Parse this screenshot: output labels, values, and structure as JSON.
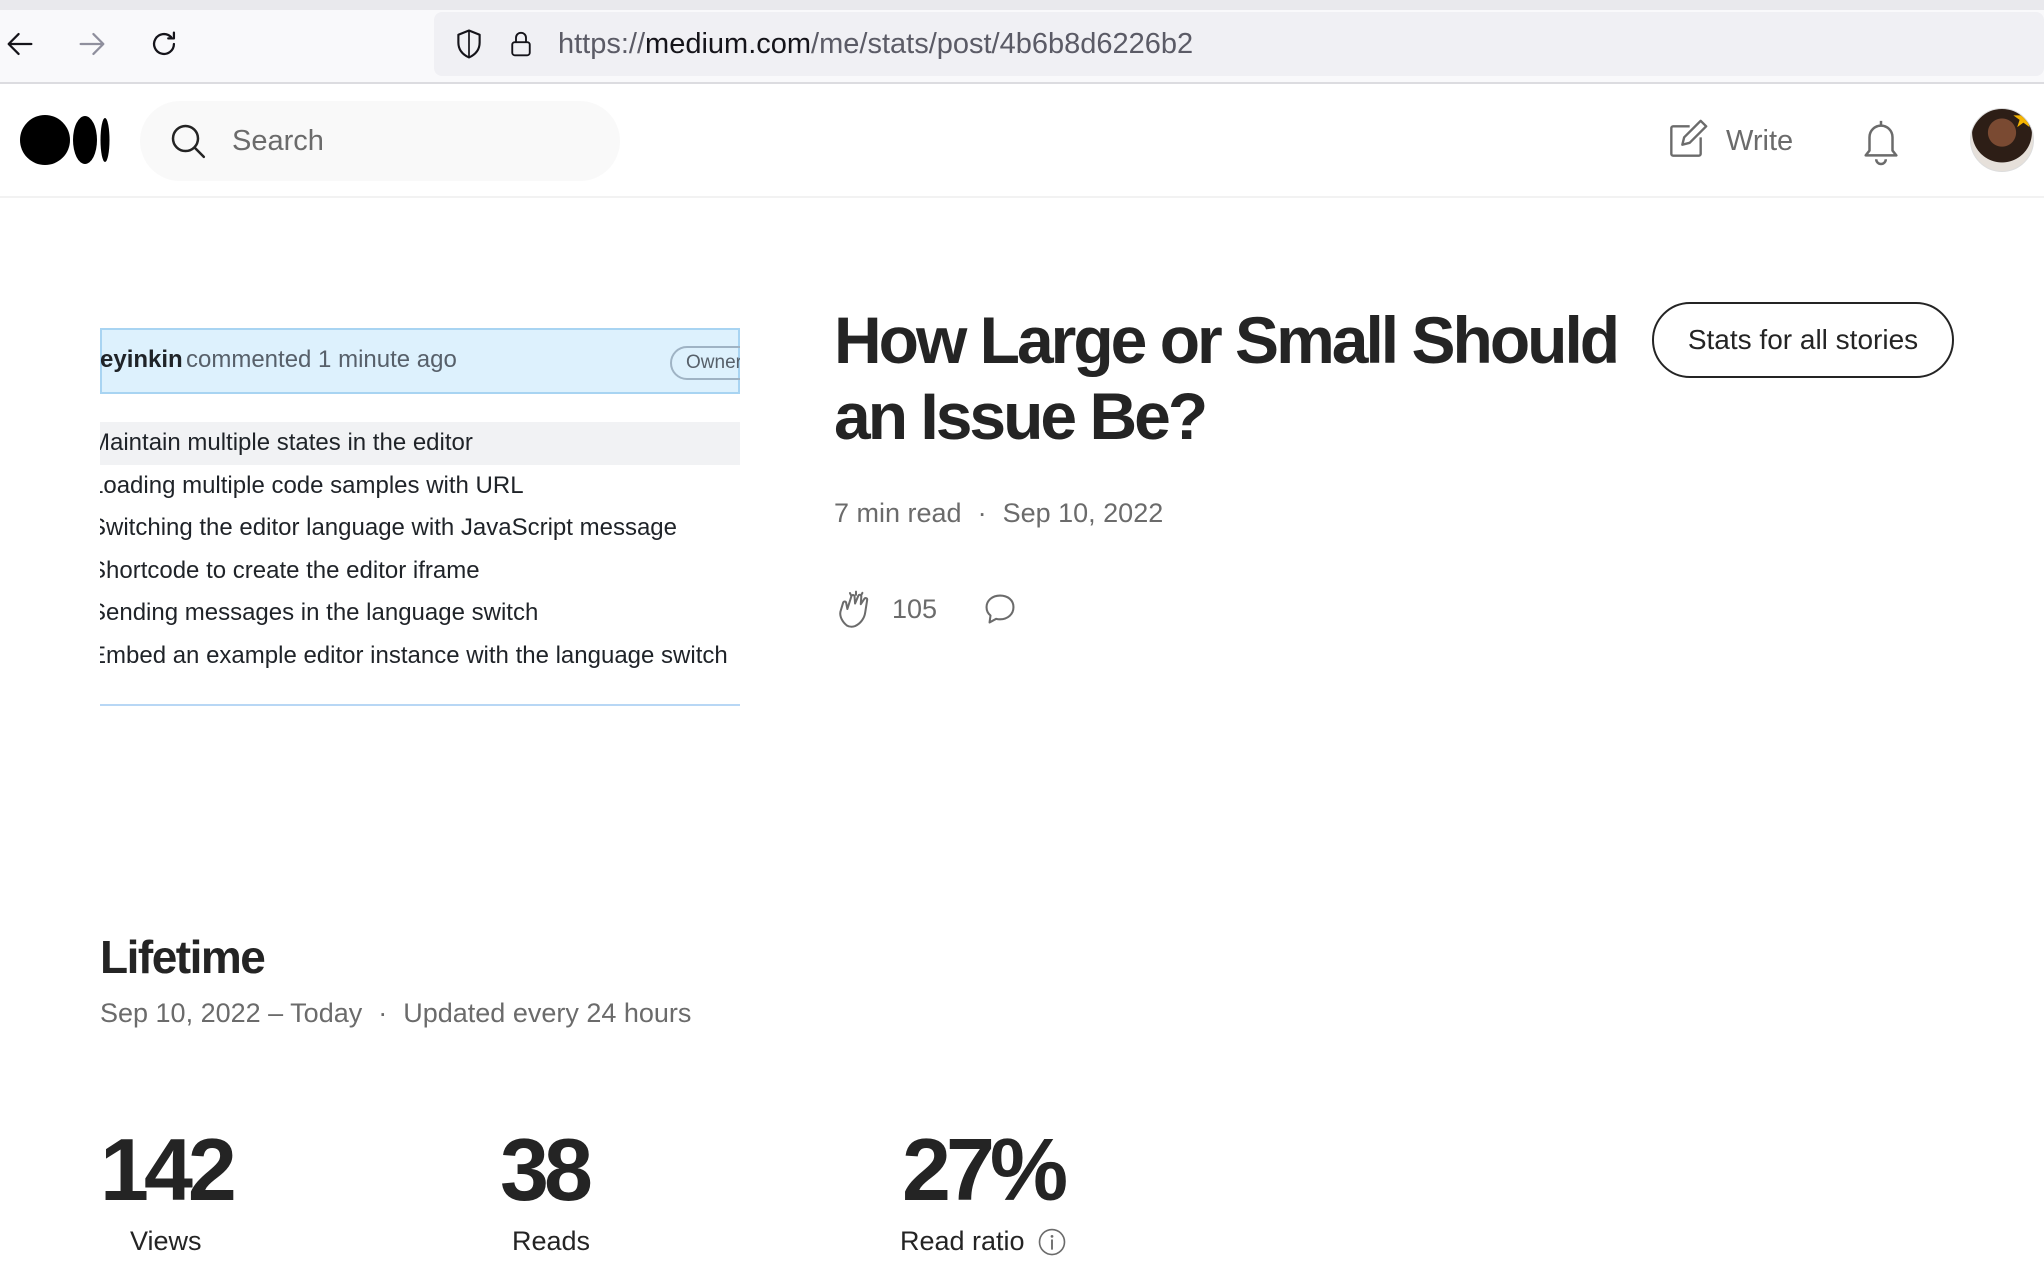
{
  "browser": {
    "url_scheme": "https://",
    "url_host": "medium.com",
    "url_path": "/me/stats/post/4b6b8d6226b2"
  },
  "header": {
    "search_placeholder": "Search",
    "write_label": "Write"
  },
  "preview": {
    "author": "eyinkin",
    "meta": "commented 1 minute ago",
    "owner_badge": "Owner",
    "tasks": [
      "Maintain multiple states in the editor",
      "Loading multiple code samples with URL",
      "Switching the editor language with JavaScript message",
      "Shortcode to create the editor iframe",
      "Sending messages in the language switch",
      "Embed an example editor instance with the language switch"
    ]
  },
  "post": {
    "title": "How Large or Small Should an Issue Be?",
    "read_time": "7 min read",
    "separator": "·",
    "date": "Sep 10, 2022",
    "claps": "105",
    "stats_button": "Stats for all stories"
  },
  "lifetime": {
    "title": "Lifetime",
    "range": "Sep 10, 2022 – Today",
    "separator": "·",
    "updated": "Updated every 24 hours",
    "stats": [
      {
        "value": "142",
        "label": "Views"
      },
      {
        "value": "38",
        "label": "Reads"
      },
      {
        "value": "27%",
        "label": "Read ratio"
      }
    ]
  },
  "colors": {
    "text": "#242424",
    "muted": "#6b6b6b",
    "comment_header_bg": "#ddf1fd"
  }
}
